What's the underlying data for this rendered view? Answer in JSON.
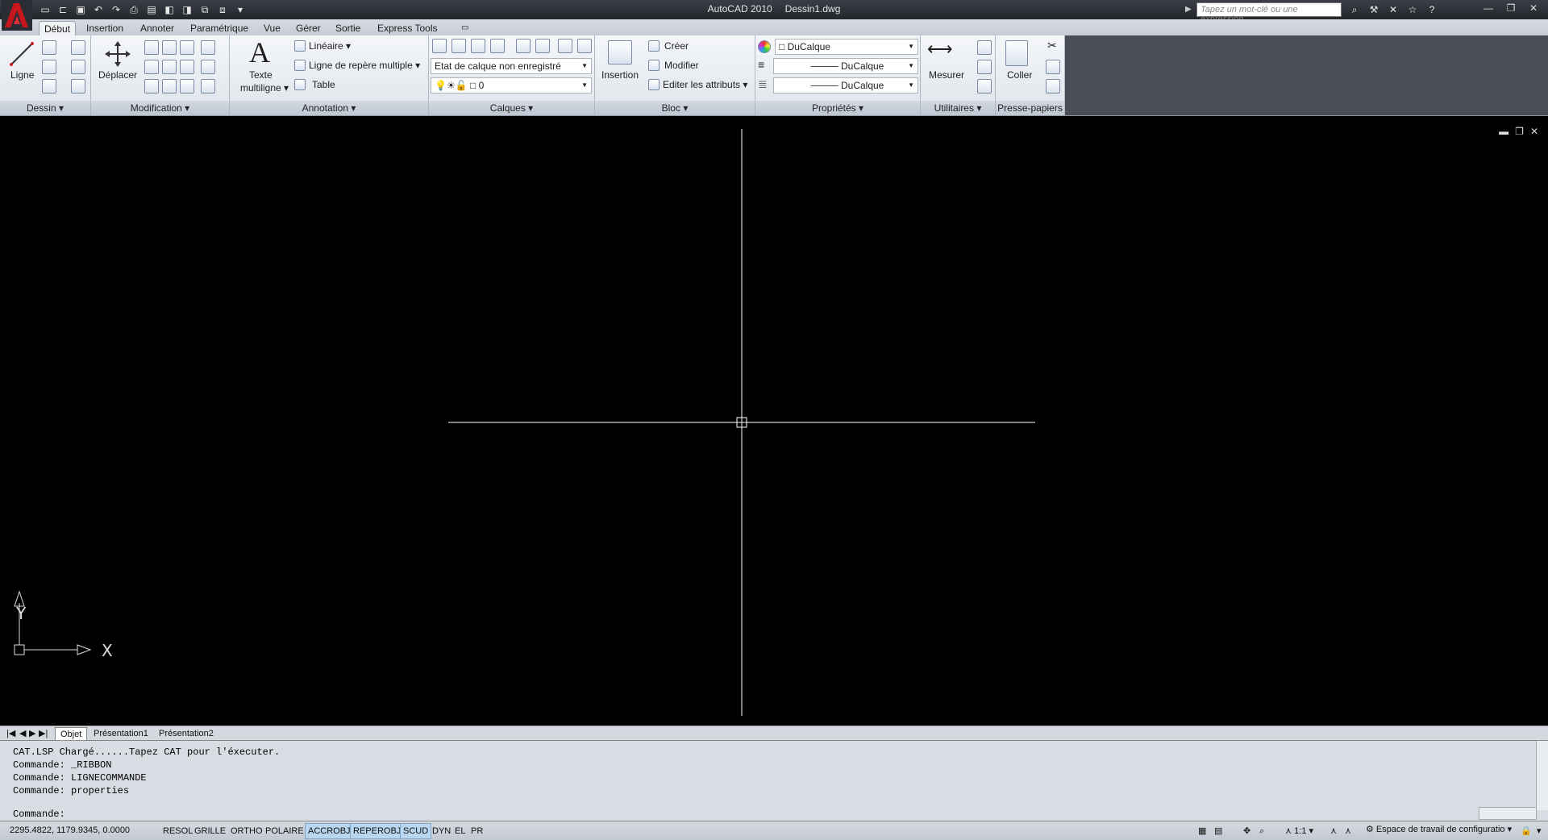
{
  "window": {
    "app_title": "AutoCAD 2010",
    "doc_title": "Dessin1.dwg"
  },
  "search": {
    "placeholder": "Tapez un mot-clé ou une expression"
  },
  "ribbon_tabs": [
    "Début",
    "Insertion",
    "Annoter",
    "Paramétrique",
    "Vue",
    "Gérer",
    "Sortie",
    "Express Tools"
  ],
  "panels": {
    "dessin": {
      "title": "Dessin",
      "ligne": "Ligne"
    },
    "modification": {
      "title": "Modification",
      "deplacer": "Déplacer"
    },
    "annotation": {
      "title": "Annotation",
      "texte": "Texte",
      "multiligne": "multiligne",
      "lineaire": "Linéaire",
      "ligne_repere": "Ligne de repère multiple",
      "table": "Table"
    },
    "calques": {
      "title": "Calques",
      "etat": "Etat de calque non enregistré",
      "layer": "0"
    },
    "bloc": {
      "title": "Bloc",
      "insertion": "Insertion",
      "creer": "Créer",
      "modifier": "Modifier",
      "editer": "Editer les attributs"
    },
    "proprietes": {
      "title": "Propriétés",
      "color": "DuCalque",
      "linetype": "DuCalque",
      "lineweight": "DuCalque"
    },
    "utilitaires": {
      "title": "Utilitaires",
      "mesurer": "Mesurer"
    },
    "presse_papiers": {
      "title": "Presse-papiers",
      "coller": "Coller"
    }
  },
  "ucs": {
    "x": "X",
    "y": "Y"
  },
  "layout_tabs": [
    "Objet",
    "Présentation1",
    "Présentation2"
  ],
  "command": {
    "history": [
      "CAT.LSP Chargé......Tapez CAT pour l'éxecuter.",
      "Commande: _RIBBON",
      "Commande: LIGNECOMMANDE",
      "Commande: properties"
    ],
    "prompt": "Commande:"
  },
  "status": {
    "coords": "2295.4822, 1179.9345, 0.0000",
    "toggles": [
      {
        "label": "RESOL",
        "on": false
      },
      {
        "label": "GRILLE",
        "on": false
      },
      {
        "label": "ORTHO",
        "on": false
      },
      {
        "label": "POLAIRE",
        "on": false
      },
      {
        "label": "ACCROBJ",
        "on": true
      },
      {
        "label": "REPEROBJ",
        "on": true
      },
      {
        "label": "SCUD",
        "on": true
      },
      {
        "label": "DYN",
        "on": false
      },
      {
        "label": "EL",
        "on": false
      },
      {
        "label": "PR",
        "on": false
      }
    ],
    "scale": "1:1",
    "workspace": "Espace de travail de configuratio"
  }
}
